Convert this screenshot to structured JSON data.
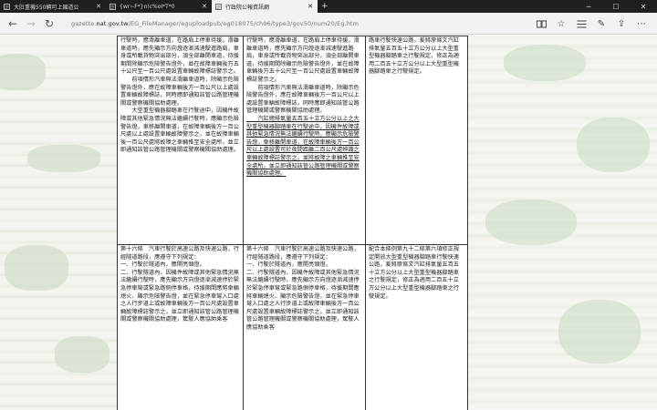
{
  "browser": {
    "tabs": [
      {
        "title": "大肚重機550轉可上國道公"
      },
      {
        "title": "{wr~F*}n!c%oI*T*0"
      },
      {
        "title": "行政院公報資訊網"
      }
    ],
    "url_prefix": "gazette.",
    "url_host": "nat.gov.tw",
    "url_path": "/EG_FileManager/eguploadpub/eg018075/ch06/type3/gov50/num20/Eg.htm"
  },
  "table": {
    "row1": {
      "col1": [
        "行駛時，應滑離車道，在路肩上停車待援，滑離車道時，應先顯示方向燈逐漸減速駛進路肩，車身或所載貨物突出部分，須全部離開車道，待援期間除顯示危險警告燈外，並在故障車輛後方五十公尺至一百公尺處設置車輛故障標誌警示之。",
        "　　前項情形汽車無法滑離車道時，除顯示危險警告燈外，應在故障車輛後方一百公尺以上處設置車輛故障標誌，同時應即通知該管公路管理機關或警察機關協助處理。",
        "　　大型重型機器腳踏車在行駛途中，因機件故障或其他緊急情況無法繼續行駛時，應顯示危險警告燈，車移離開車道，在故障車輛後方一百公尺處以上處設置車輛故障警示之，並在故障車輛後一百公尺處將故障之車輛推至安全處所，並立即通知該管公路管理機關或警察機關協助處理。"
      ],
      "col2": [
        "行駛時，應滑離車道，在路肩上停車待援，滑離車道時，應先顯示方向燈逐漸減速駛進路肩，車身或所載貨物突出部分，須全部離開車道，待援期間除顯示危險警告燈外，並在故障車輛後方五十公尺至一百公尺處設置車輛故障標誌警示之。",
        "　　前項情形汽車無法滑離車道時，除顯示危險警告燈外，應在故障車輛後方一百公尺以上處設置車輛故障標誌，同時應即通知該管公路管理機關或警察機關協助處理。"
      ],
      "col2_underlined": "　　汽缸總排氣量五百五十立方公分以上之大型重型機器腳踏車在行駛途中，因機件故障或其他緊急情況無法繼續行駛時，應顯示危險警告燈，車移離開車道，在故障車輛後方一百公尺以上處設置可於夜間距離二百公尺處辨識之車輛故障標誌警示之，並將故障之車輛推至安全處所，並立即通知該管公路管理機關或警察機關協助處理。",
      "col3": "路車行駛快速公路，爰將原條文汽缸排氣量五百五十立方公分以上大型重型機器腳踏車之行駛規定，修正為適用二百五十立方公分以上大型重型機器腳踏車之行駛規定。"
    },
    "row2": {
      "col1": [
        "第十六條　汽車行駛於高速公路及快速公路，行經隧道路段，應遵守下列規定：",
        "一、行駛於隧道內，應開亮頭燈。",
        "二、行駛隧道內，因機件故障或其他緊急情況無法繼續行駛時，應先顯示方向燈逐漸減速停於緊急停車彎或緊急路側停車格，待援期間應將車輛熄火、顯示危險警告燈，並在緊急停車彎入口處之人行步道上或故障車輛後方一百公尺處設置車輛故障標誌警示之，並立即通知該管公路管理機關或警察機關協助處理，駕駛人應協助乘客"
      ],
      "col2": [
        "第十六條　汽車行駛於高速公路及快速公路，行經隧道路段，應遵守下列規定：",
        "一、行駛於隧道內，應開亮頭燈。",
        "二、行駛隧道內，因機件故障或其他緊急情況無法繼續行駛時，應先顯示方向燈逐漸減速停於緊急停車彎或緊急路側停車格，待援期間應將車輛熄火、顯示危險警告燈，並在緊急停車彎入口處之人行步道上或故障車輛後方一百公尺處設置車輛故障標誌警示之，並立即通知該管公路管理機關或警察機關協助處理，駕駛人應協助乘客"
      ],
      "col3": "配合本條例第九十二條第六項修正規定開放大型重型機器腳踏車行駛快速公路，爰將原條文汽缸排氣量五百五十立方公分以上大型重型機器腳踏車之行駛規定，修正為適用二百五十立方公分以上大型重型機器腳踏車之行駛規定。"
    }
  }
}
